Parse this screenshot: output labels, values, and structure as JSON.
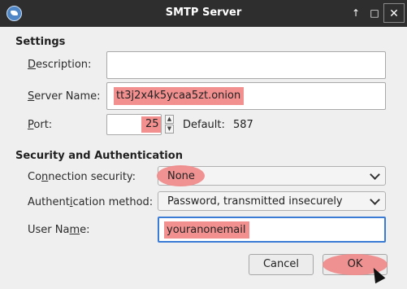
{
  "window": {
    "title": "SMTP Server",
    "controls": [
      "↑",
      "□",
      "✕"
    ]
  },
  "settings": {
    "heading": "Settings",
    "description_label": "Description:",
    "description_value": "",
    "server_label": "Server Name:",
    "server_value": "tt3j2x4k5ycaa5zt.onion",
    "port_label": "Port:",
    "port_value": "25",
    "default_label": "Default:",
    "default_value": "587"
  },
  "security": {
    "heading": "Security and Authentication",
    "connection_label": "Connection security:",
    "connection_value": "None",
    "auth_label": "Authentication method:",
    "auth_value": "Password, transmitted insecurely",
    "username_label": "User Name:",
    "username_value": "youranonemail"
  },
  "buttons": {
    "cancel": "Cancel",
    "ok": "OK"
  },
  "colors": {
    "highlight": "#f28f8f",
    "focus": "#3a7bd5",
    "titlebar": "#2e2e2e"
  },
  "icons": {
    "app": "thunderbird-icon",
    "up": "up-arrow-icon",
    "maximize": "maximize-icon",
    "close": "close-icon"
  }
}
